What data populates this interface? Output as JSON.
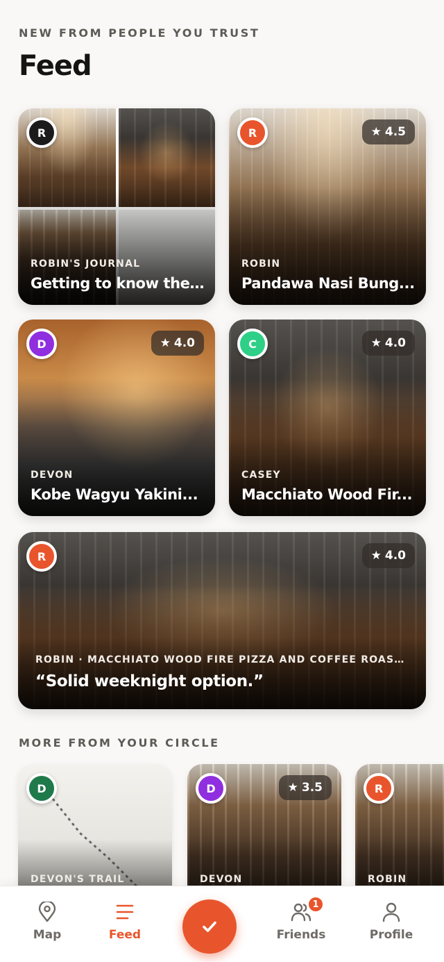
{
  "header": {
    "kicker": "NEW FROM PEOPLE YOU TRUST",
    "title": "Feed"
  },
  "feed_cards": [
    {
      "avatar_initial": "R",
      "avatar_color": "#1b1b1b",
      "label": "ROBIN'S JOURNAL",
      "title": "Getting to know the ...",
      "rating": ""
    },
    {
      "avatar_initial": "R",
      "avatar_color": "#e8552c",
      "label": "ROBIN",
      "title": "Pandawa Nasi Bung...",
      "rating": "4.5"
    },
    {
      "avatar_initial": "D",
      "avatar_color": "#8f2fe0",
      "label": "DEVON",
      "title": "Kobe Wagyu Yakini...",
      "rating": "4.0"
    },
    {
      "avatar_initial": "C",
      "avatar_color": "#2ecf86",
      "label": "CASEY",
      "title": "Macchiato Wood Fir...",
      "rating": "4.0"
    },
    {
      "avatar_initial": "R",
      "avatar_color": "#e8552c",
      "label": "ROBIN · MACCHIATO WOOD FIRE PIZZA AND COFFEE ROASTE...",
      "title": "“Solid weeknight option.”",
      "rating": "4.0"
    }
  ],
  "circle": {
    "heading": "MORE FROM YOUR CIRCLE",
    "cards": [
      {
        "avatar_initial": "D",
        "avatar_color": "#1e7a4a",
        "label": "DEVON'S TRAIL",
        "rating": ""
      },
      {
        "avatar_initial": "D",
        "avatar_color": "#8f2fe0",
        "label": "DEVON",
        "rating": "3.5"
      },
      {
        "avatar_initial": "R",
        "avatar_color": "#e8552c",
        "label": "ROBIN",
        "rating": ""
      }
    ]
  },
  "nav": {
    "map_label": "Map",
    "feed_label": "Feed",
    "friends_label": "Friends",
    "friends_badge": "1",
    "profile_label": "Profile",
    "accent": "#e8552c"
  }
}
